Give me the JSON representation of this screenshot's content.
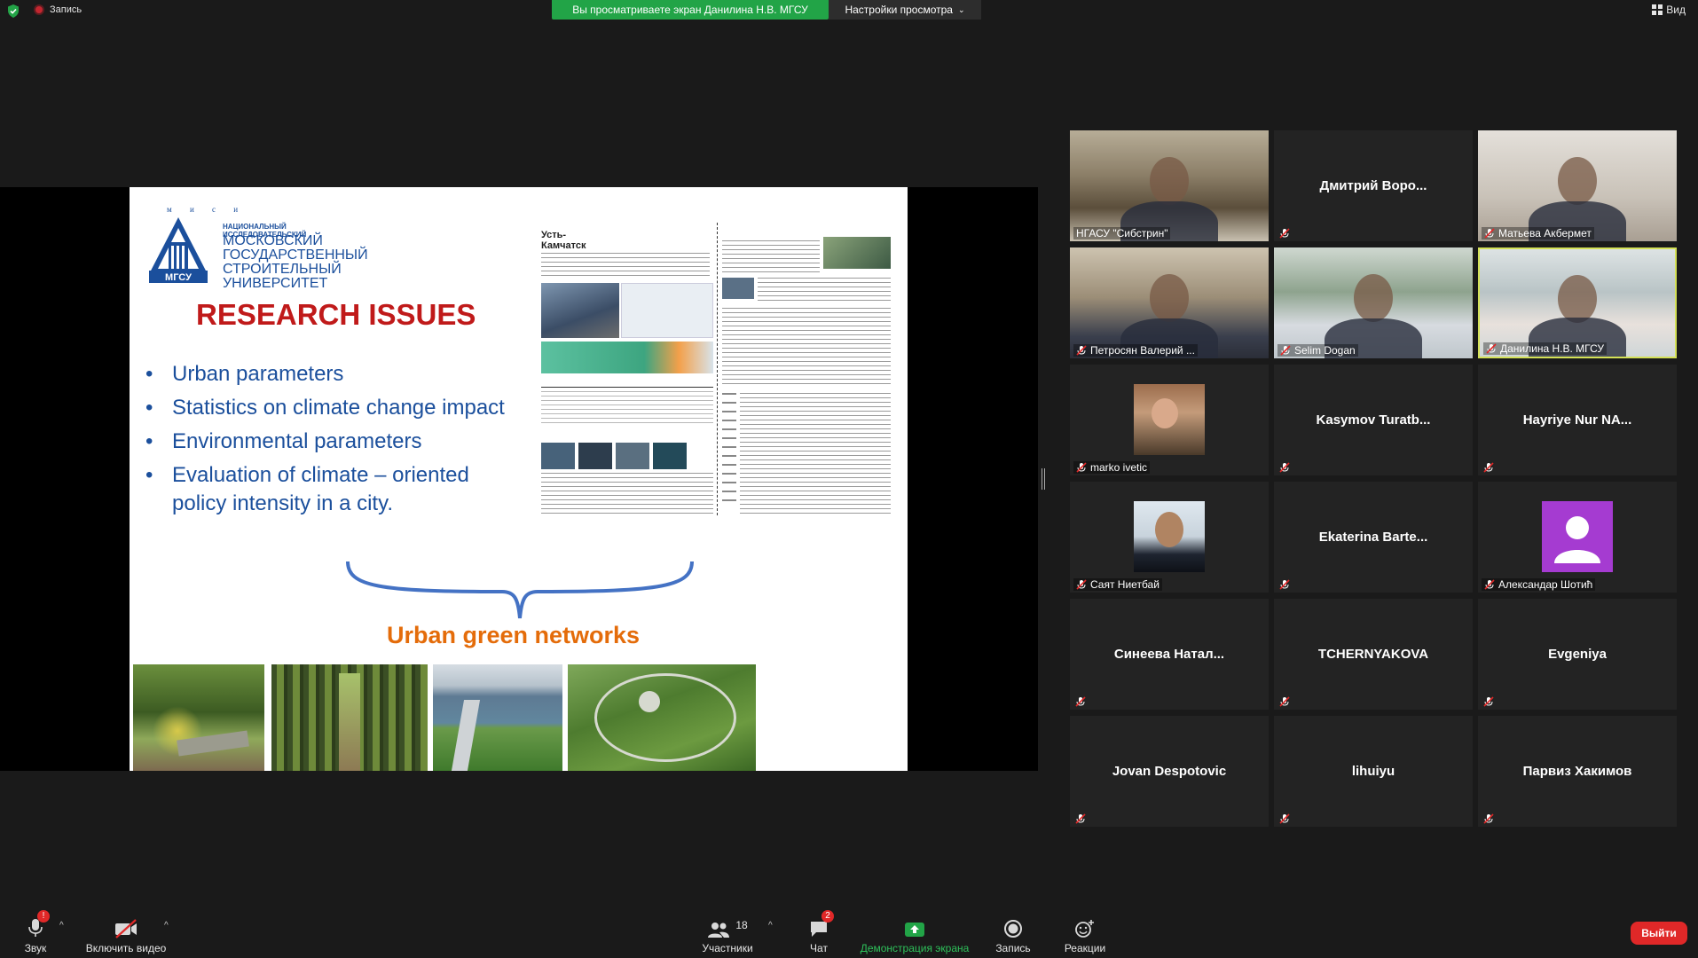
{
  "topbar": {
    "recording_label": "Запись",
    "share_banner": "Вы просматриваете экран Данилина Н.В. МГСУ",
    "view_settings": "Настройки просмотра",
    "view_button": "Вид"
  },
  "slide": {
    "logo_letters": "м и с и",
    "logo_abbr": "МГСУ",
    "univ_small": "НАЦИОНАЛЬНЫЙ ИССЛЕДОВАТЕЛЬСКИЙ",
    "univ_lines": [
      "МОСКОВСКИЙ",
      "ГОСУДАРСТВЕННЫЙ",
      "СТРОИТЕЛЬНЫЙ",
      "УНИВЕРСИТЕТ"
    ],
    "title": "RESEARCH ISSUES",
    "bullets": [
      "Urban parameters",
      "Statistics on climate change impact",
      "Environmental parameters",
      "Evaluation of climate – oriented\npolicy intensity in a city."
    ],
    "footer_title": "Urban green networks",
    "poster_title": "Усть-\nКамчатск",
    "colors": {
      "title": "#c01a1a",
      "bullets": "#1b4f9c",
      "footer": "#e46c0a"
    }
  },
  "participants": [
    {
      "name": "НГАСУ \"Сибстрин\"",
      "type": "video",
      "muted": false
    },
    {
      "name": "Дмитрий  Воро...",
      "type": "name",
      "muted": true
    },
    {
      "name": "Матьева Акбермет",
      "type": "video",
      "muted": true
    },
    {
      "name": "Петросян Валерий ...",
      "type": "video",
      "muted": true
    },
    {
      "name": "Selim Dogan",
      "type": "video",
      "muted": true
    },
    {
      "name": "Данилина Н.В. МГСУ",
      "type": "video",
      "muted": true,
      "active": true
    },
    {
      "name": "marko ivetic",
      "type": "avatar",
      "muted": true
    },
    {
      "name": "Kasymov  Turatb...",
      "type": "name",
      "muted": true
    },
    {
      "name": "Hayriye Nur NA...",
      "type": "name",
      "muted": true
    },
    {
      "name": "Саят Ниетбай",
      "type": "avatar",
      "muted": true
    },
    {
      "name": "Ekaterina  Barte...",
      "type": "name",
      "muted": true
    },
    {
      "name": "Александар Шотић",
      "type": "avatar",
      "muted": true
    },
    {
      "name": "Синеева  Натал...",
      "type": "name",
      "muted": true
    },
    {
      "name": "TCHERNYAKOVA",
      "type": "name",
      "muted": true
    },
    {
      "name": "Evgeniya",
      "type": "name",
      "muted": true
    },
    {
      "name": "Jovan Despotovic",
      "type": "name",
      "muted": true
    },
    {
      "name": "lihuiyu",
      "type": "name",
      "muted": true
    },
    {
      "name": "Парвиз Хакимов",
      "type": "name",
      "muted": true
    }
  ],
  "toolbar": {
    "audio_label": "Звук",
    "video_label": "Включить видео",
    "participants_label": "Участники",
    "participants_count": "18",
    "chat_label": "Чат",
    "chat_badge": "2",
    "share_label": "Демонстрация экрана",
    "record_label": "Запись",
    "reactions_label": "Реакции",
    "leave_label": "Выйти",
    "audio_badge": "!"
  }
}
